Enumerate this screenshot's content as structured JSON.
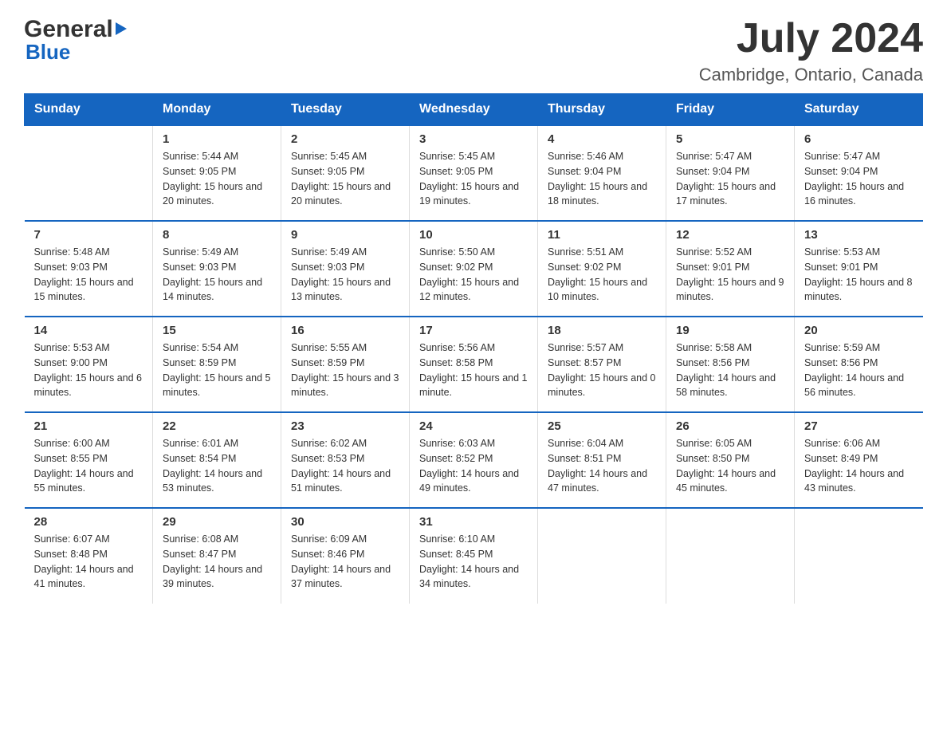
{
  "logo": {
    "text_general": "General",
    "triangle": "▶",
    "text_blue": "Blue"
  },
  "header": {
    "month_year": "July 2024",
    "location": "Cambridge, Ontario, Canada"
  },
  "weekdays": [
    "Sunday",
    "Monday",
    "Tuesday",
    "Wednesday",
    "Thursday",
    "Friday",
    "Saturday"
  ],
  "weeks": [
    [
      {
        "day": "",
        "sunrise": "",
        "sunset": "",
        "daylight": ""
      },
      {
        "day": "1",
        "sunrise": "Sunrise: 5:44 AM",
        "sunset": "Sunset: 9:05 PM",
        "daylight": "Daylight: 15 hours and 20 minutes."
      },
      {
        "day": "2",
        "sunrise": "Sunrise: 5:45 AM",
        "sunset": "Sunset: 9:05 PM",
        "daylight": "Daylight: 15 hours and 20 minutes."
      },
      {
        "day": "3",
        "sunrise": "Sunrise: 5:45 AM",
        "sunset": "Sunset: 9:05 PM",
        "daylight": "Daylight: 15 hours and 19 minutes."
      },
      {
        "day": "4",
        "sunrise": "Sunrise: 5:46 AM",
        "sunset": "Sunset: 9:04 PM",
        "daylight": "Daylight: 15 hours and 18 minutes."
      },
      {
        "day": "5",
        "sunrise": "Sunrise: 5:47 AM",
        "sunset": "Sunset: 9:04 PM",
        "daylight": "Daylight: 15 hours and 17 minutes."
      },
      {
        "day": "6",
        "sunrise": "Sunrise: 5:47 AM",
        "sunset": "Sunset: 9:04 PM",
        "daylight": "Daylight: 15 hours and 16 minutes."
      }
    ],
    [
      {
        "day": "7",
        "sunrise": "Sunrise: 5:48 AM",
        "sunset": "Sunset: 9:03 PM",
        "daylight": "Daylight: 15 hours and 15 minutes."
      },
      {
        "day": "8",
        "sunrise": "Sunrise: 5:49 AM",
        "sunset": "Sunset: 9:03 PM",
        "daylight": "Daylight: 15 hours and 14 minutes."
      },
      {
        "day": "9",
        "sunrise": "Sunrise: 5:49 AM",
        "sunset": "Sunset: 9:03 PM",
        "daylight": "Daylight: 15 hours and 13 minutes."
      },
      {
        "day": "10",
        "sunrise": "Sunrise: 5:50 AM",
        "sunset": "Sunset: 9:02 PM",
        "daylight": "Daylight: 15 hours and 12 minutes."
      },
      {
        "day": "11",
        "sunrise": "Sunrise: 5:51 AM",
        "sunset": "Sunset: 9:02 PM",
        "daylight": "Daylight: 15 hours and 10 minutes."
      },
      {
        "day": "12",
        "sunrise": "Sunrise: 5:52 AM",
        "sunset": "Sunset: 9:01 PM",
        "daylight": "Daylight: 15 hours and 9 minutes."
      },
      {
        "day": "13",
        "sunrise": "Sunrise: 5:53 AM",
        "sunset": "Sunset: 9:01 PM",
        "daylight": "Daylight: 15 hours and 8 minutes."
      }
    ],
    [
      {
        "day": "14",
        "sunrise": "Sunrise: 5:53 AM",
        "sunset": "Sunset: 9:00 PM",
        "daylight": "Daylight: 15 hours and 6 minutes."
      },
      {
        "day": "15",
        "sunrise": "Sunrise: 5:54 AM",
        "sunset": "Sunset: 8:59 PM",
        "daylight": "Daylight: 15 hours and 5 minutes."
      },
      {
        "day": "16",
        "sunrise": "Sunrise: 5:55 AM",
        "sunset": "Sunset: 8:59 PM",
        "daylight": "Daylight: 15 hours and 3 minutes."
      },
      {
        "day": "17",
        "sunrise": "Sunrise: 5:56 AM",
        "sunset": "Sunset: 8:58 PM",
        "daylight": "Daylight: 15 hours and 1 minute."
      },
      {
        "day": "18",
        "sunrise": "Sunrise: 5:57 AM",
        "sunset": "Sunset: 8:57 PM",
        "daylight": "Daylight: 15 hours and 0 minutes."
      },
      {
        "day": "19",
        "sunrise": "Sunrise: 5:58 AM",
        "sunset": "Sunset: 8:56 PM",
        "daylight": "Daylight: 14 hours and 58 minutes."
      },
      {
        "day": "20",
        "sunrise": "Sunrise: 5:59 AM",
        "sunset": "Sunset: 8:56 PM",
        "daylight": "Daylight: 14 hours and 56 minutes."
      }
    ],
    [
      {
        "day": "21",
        "sunrise": "Sunrise: 6:00 AM",
        "sunset": "Sunset: 8:55 PM",
        "daylight": "Daylight: 14 hours and 55 minutes."
      },
      {
        "day": "22",
        "sunrise": "Sunrise: 6:01 AM",
        "sunset": "Sunset: 8:54 PM",
        "daylight": "Daylight: 14 hours and 53 minutes."
      },
      {
        "day": "23",
        "sunrise": "Sunrise: 6:02 AM",
        "sunset": "Sunset: 8:53 PM",
        "daylight": "Daylight: 14 hours and 51 minutes."
      },
      {
        "day": "24",
        "sunrise": "Sunrise: 6:03 AM",
        "sunset": "Sunset: 8:52 PM",
        "daylight": "Daylight: 14 hours and 49 minutes."
      },
      {
        "day": "25",
        "sunrise": "Sunrise: 6:04 AM",
        "sunset": "Sunset: 8:51 PM",
        "daylight": "Daylight: 14 hours and 47 minutes."
      },
      {
        "day": "26",
        "sunrise": "Sunrise: 6:05 AM",
        "sunset": "Sunset: 8:50 PM",
        "daylight": "Daylight: 14 hours and 45 minutes."
      },
      {
        "day": "27",
        "sunrise": "Sunrise: 6:06 AM",
        "sunset": "Sunset: 8:49 PM",
        "daylight": "Daylight: 14 hours and 43 minutes."
      }
    ],
    [
      {
        "day": "28",
        "sunrise": "Sunrise: 6:07 AM",
        "sunset": "Sunset: 8:48 PM",
        "daylight": "Daylight: 14 hours and 41 minutes."
      },
      {
        "day": "29",
        "sunrise": "Sunrise: 6:08 AM",
        "sunset": "Sunset: 8:47 PM",
        "daylight": "Daylight: 14 hours and 39 minutes."
      },
      {
        "day": "30",
        "sunrise": "Sunrise: 6:09 AM",
        "sunset": "Sunset: 8:46 PM",
        "daylight": "Daylight: 14 hours and 37 minutes."
      },
      {
        "day": "31",
        "sunrise": "Sunrise: 6:10 AM",
        "sunset": "Sunset: 8:45 PM",
        "daylight": "Daylight: 14 hours and 34 minutes."
      },
      {
        "day": "",
        "sunrise": "",
        "sunset": "",
        "daylight": ""
      },
      {
        "day": "",
        "sunrise": "",
        "sunset": "",
        "daylight": ""
      },
      {
        "day": "",
        "sunrise": "",
        "sunset": "",
        "daylight": ""
      }
    ]
  ]
}
